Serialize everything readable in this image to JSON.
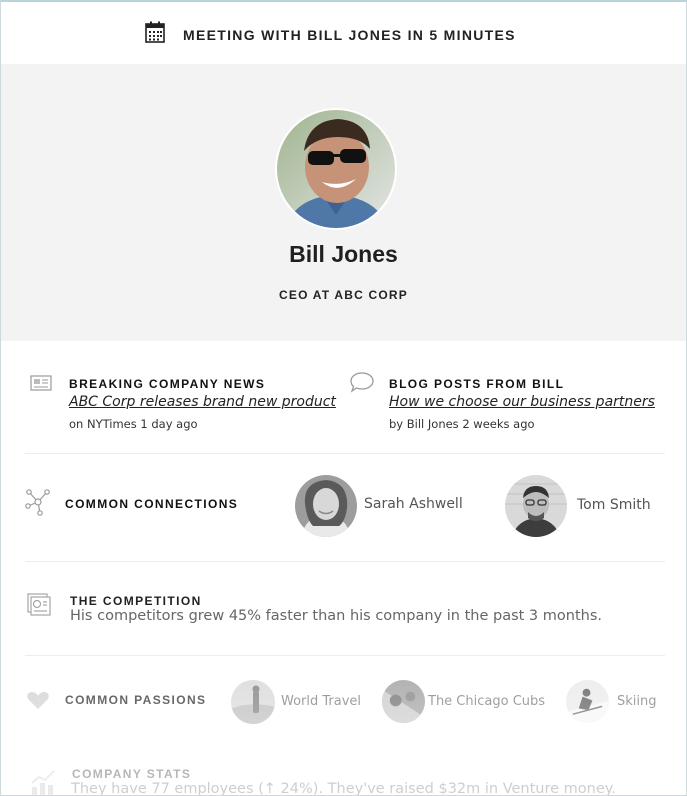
{
  "header": {
    "text": "MEETING WITH BILL JONES IN 5 MINUTES",
    "icon": "calendar-icon"
  },
  "profile": {
    "name": "Bill Jones",
    "title": "CEO AT ABC CORP"
  },
  "news": {
    "label": "BREAKING COMPANY NEWS",
    "headline": "ABC Corp releases brand new product",
    "meta": "on NYTimes 1 day ago",
    "icon": "newspaper-icon"
  },
  "blog": {
    "label": "BLOG POSTS FROM BILL",
    "headline": "How we choose our business partners",
    "meta": "by Bill Jones 2 weeks ago",
    "icon": "speech-bubble-icon"
  },
  "connections": {
    "label": "COMMON CONNECTIONS",
    "icon": "network-icon",
    "people": [
      {
        "name": "Sarah Ashwell"
      },
      {
        "name": "Tom Smith"
      }
    ]
  },
  "competition": {
    "label": "THE COMPETITION",
    "text": "His competitors grew 45% faster than his company in the past 3 months.",
    "icon": "presentation-icon"
  },
  "passions": {
    "label": "COMMON PASSIONS",
    "icon": "heart-icon",
    "items": [
      {
        "name": "World Travel"
      },
      {
        "name": "The Chicago Cubs"
      },
      {
        "name": "Skiing"
      }
    ]
  },
  "stats": {
    "label": "COMPANY STATS",
    "text": "They have 77 employees (↑ 24%). They've raised $32m in Venture money.",
    "icon": "bar-chart-icon"
  },
  "colors": {
    "hero_bg": "#f3f3f3",
    "text": "#222222",
    "muted": "#666666"
  }
}
